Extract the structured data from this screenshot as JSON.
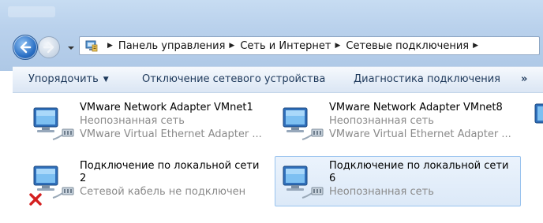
{
  "address_bar": {
    "crumbs": [
      "Панель управления",
      "Сеть и Интернет",
      "Сетевые подключения"
    ]
  },
  "toolbar": {
    "organize": "Упорядочить",
    "disable_device": "Отключение сетевого устройства",
    "diagnose": "Диагностика подключения",
    "more": "»"
  },
  "connections": [
    {
      "name": "VMware Network Adapter VMnet1",
      "status": "Неопознанная сеть",
      "device": "VMware Virtual Ethernet Adapter ...",
      "icon": "network-adapter-icon"
    },
    {
      "name": "VMware Network Adapter VMnet8",
      "status": "Неопознанная сеть",
      "device": "VMware Virtual Ethernet Adapter ...",
      "icon": "network-adapter-icon"
    },
    {
      "name_line1": "Подключение по локальной сети",
      "name_line2": "2",
      "status": "Сетевой кабель не подключен",
      "icon": "network-adapter-disconnected-icon"
    },
    {
      "name_line1": "Подключение по локальной сети",
      "name_line2": "6",
      "status": "Неопознанная сеть",
      "icon": "network-adapter-icon",
      "selected": true
    }
  ],
  "colors": {
    "accent": "#1e395b",
    "selection_border": "#99c3ee",
    "secondary_text": "#8a8a8a",
    "error_red": "#d42020"
  }
}
